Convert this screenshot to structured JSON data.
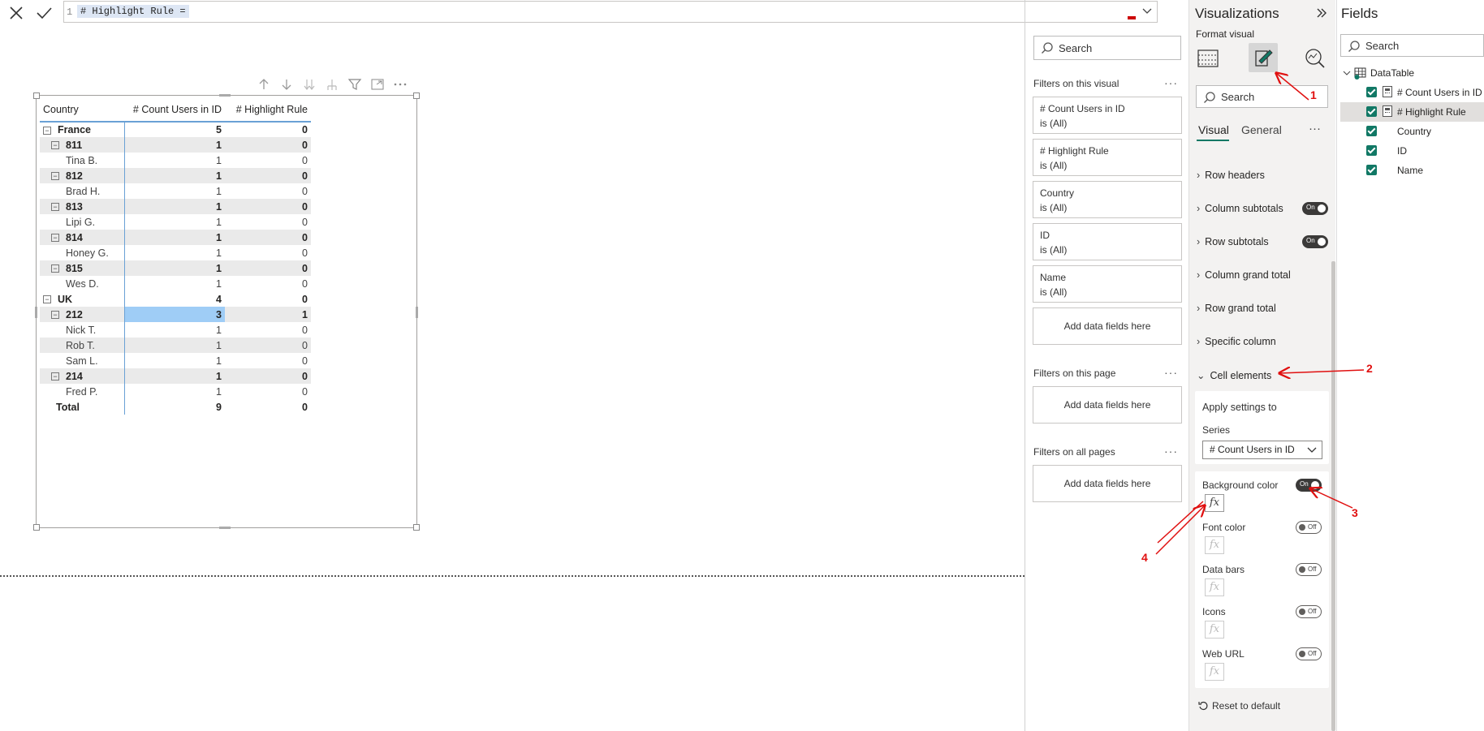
{
  "formula": {
    "line_number": "1",
    "text": "# Highlight Rule ="
  },
  "visual_toolbar": [
    "arrow-up-icon",
    "arrow-down-icon",
    "double-arrow-down-icon",
    "expand-all-icon",
    "filter-icon",
    "focus-mode-icon",
    "more-options-icon"
  ],
  "matrix": {
    "headers": [
      "Country",
      "# Count Users in ID",
      "# Highlight Rule"
    ],
    "rows": [
      {
        "level": 0,
        "label": "France",
        "count": "5",
        "highlight": "0"
      },
      {
        "level": 1,
        "label": "811",
        "count": "1",
        "highlight": "0"
      },
      {
        "level": 2,
        "label": "Tina B.",
        "count": "1",
        "highlight": "0"
      },
      {
        "level": 1,
        "label": "812",
        "count": "1",
        "highlight": "0"
      },
      {
        "level": 2,
        "label": "Brad H.",
        "count": "1",
        "highlight": "0"
      },
      {
        "level": 1,
        "label": "813",
        "count": "1",
        "highlight": "0"
      },
      {
        "level": 2,
        "label": "Lipi G.",
        "count": "1",
        "highlight": "0"
      },
      {
        "level": 1,
        "label": "814",
        "count": "1",
        "highlight": "0"
      },
      {
        "level": 2,
        "label": "Honey G.",
        "count": "1",
        "highlight": "0"
      },
      {
        "level": 1,
        "label": "815",
        "count": "1",
        "highlight": "0"
      },
      {
        "level": 2,
        "label": "Wes D.",
        "count": "1",
        "highlight": "0"
      },
      {
        "level": 0,
        "label": "UK",
        "count": "4",
        "highlight": "0"
      },
      {
        "level": 1,
        "label": "212",
        "count": "3",
        "highlight": "1",
        "selected": true
      },
      {
        "level": 2,
        "label": "Nick T.",
        "count": "1",
        "highlight": "0"
      },
      {
        "level": 2,
        "label": "Rob T.",
        "count": "1",
        "highlight": "0",
        "alt": true
      },
      {
        "level": 2,
        "label": "Sam L.",
        "count": "1",
        "highlight": "0"
      },
      {
        "level": 1,
        "label": "214",
        "count": "1",
        "highlight": "0"
      },
      {
        "level": 2,
        "label": "Fred P.",
        "count": "1",
        "highlight": "0"
      }
    ],
    "total": {
      "label": "Total",
      "count": "9",
      "highlight": "0"
    },
    "selected_color": "#9fcdf6",
    "header_rule_color": "#6aa1d5"
  },
  "filters": {
    "search_placeholder": "Search",
    "on_visual_title": "Filters on this visual",
    "on_visual": [
      {
        "field": "# Count Users in ID",
        "state": "is (All)"
      },
      {
        "field": "# Highlight Rule",
        "state": "is (All)"
      },
      {
        "field": "Country",
        "state": "is (All)"
      },
      {
        "field": "ID",
        "state": "is (All)"
      },
      {
        "field": "Name",
        "state": "is (All)"
      }
    ],
    "add_label": "Add data fields here",
    "on_page_title": "Filters on this page",
    "on_all_title": "Filters on all pages",
    "more": "···"
  },
  "visualizations": {
    "title": "Visualizations",
    "format_label": "Format visual",
    "search_placeholder": "Search",
    "tabs": [
      "Visual",
      "General"
    ],
    "tab_more": "···",
    "sections": [
      {
        "label": "Row headers",
        "toggle": null
      },
      {
        "label": "Column subtotals",
        "toggle": "On"
      },
      {
        "label": "Row subtotals",
        "toggle": "On"
      },
      {
        "label": "Column grand total",
        "toggle": null
      },
      {
        "label": "Row grand total",
        "toggle": null
      },
      {
        "label": "Specific column",
        "toggle": null
      },
      {
        "label": "Cell elements",
        "toggle": null,
        "expanded": true
      }
    ],
    "apply_settings": "Apply settings to",
    "series_label": "Series",
    "series_value": "# Count Users in ID",
    "cell_options": [
      {
        "label": "Background color",
        "state": "On"
      },
      {
        "label": "Font color",
        "state": "Off"
      },
      {
        "label": "Data bars",
        "state": "Off"
      },
      {
        "label": "Icons",
        "state": "Off"
      },
      {
        "label": "Web URL",
        "state": "Off"
      }
    ],
    "fx_label": "fx",
    "reset": "Reset to default",
    "accent_color": "#117865"
  },
  "fields": {
    "title": "Fields",
    "search_placeholder": "Search",
    "table_name": "DataTable",
    "items": [
      {
        "label": "# Count Users in ID",
        "measure": true
      },
      {
        "label": "# Highlight Rule",
        "measure": true,
        "selected": true
      },
      {
        "label": "Country",
        "measure": false
      },
      {
        "label": "ID",
        "measure": false
      },
      {
        "label": "Name",
        "measure": false
      }
    ]
  },
  "annotations": [
    "1",
    "2",
    "3",
    "4"
  ],
  "annotation_color": "#e01010"
}
